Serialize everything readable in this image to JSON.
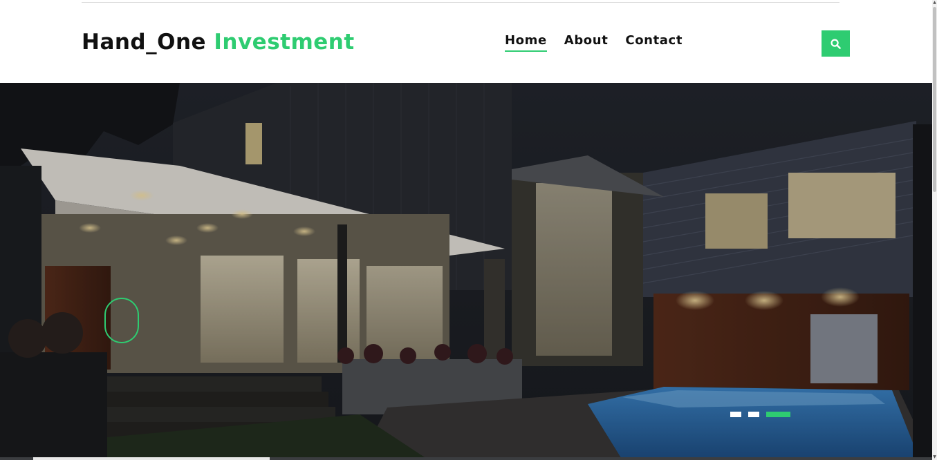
{
  "brand": {
    "name_main": "Hand_One",
    "name_accent": "Investment"
  },
  "nav": {
    "items": [
      {
        "label": "Home",
        "active": true
      },
      {
        "label": "About",
        "active": false
      },
      {
        "label": "Contact",
        "active": false
      }
    ]
  },
  "search": {
    "icon": "search-icon"
  },
  "hero": {
    "slides_total": 3,
    "active_slide": 3
  },
  "colors": {
    "accent": "#2ecc71",
    "text": "#111111",
    "background": "#ffffff"
  }
}
